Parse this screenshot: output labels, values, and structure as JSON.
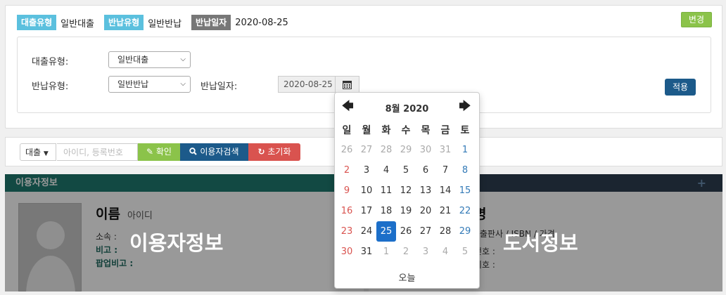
{
  "summary": {
    "loan_type_tag": "대출유형",
    "loan_type_value": "일반대출",
    "return_type_tag": "반납유형",
    "return_type_value": "일반반납",
    "return_date_tag": "반납일자",
    "return_date_value": "2020-08-25",
    "change_button": "변경"
  },
  "form": {
    "loan_type_label": "대출유형:",
    "loan_type_selected": "일반대출",
    "return_type_label": "반납유형:",
    "return_type_selected": "일반반납",
    "return_date_label": "반납일자:",
    "return_date_value": "2020-08-25",
    "apply_button": "적용"
  },
  "search": {
    "type_label": "대출",
    "placeholder": "아이디, 등록번호",
    "confirm_button": "확인",
    "user_search_button": "이용자검색",
    "reset_button": "초기화"
  },
  "user_panel": {
    "header": "이용자정보",
    "name_label": "이름",
    "id_label": "아이디",
    "affiliation_label": "소속 :",
    "note_label": "비고 :",
    "popup_note_label": "팝업비고 :",
    "overlay_text": "이용자정보"
  },
  "book_panel": {
    "title_partial": "명",
    "publisher_line": "/ 출판사 / ISBN / 가격",
    "number_partial": "번호 :",
    "symbol_partial": "기호 :",
    "overlay_text": "도서정보"
  },
  "datepicker": {
    "title": "8월 2020",
    "weekdays": [
      "일",
      "월",
      "화",
      "수",
      "목",
      "금",
      "토"
    ],
    "weeks": [
      [
        "26",
        "27",
        "28",
        "29",
        "30",
        "31",
        "1"
      ],
      [
        "2",
        "3",
        "4",
        "5",
        "6",
        "7",
        "8"
      ],
      [
        "9",
        "10",
        "11",
        "12",
        "13",
        "14",
        "15"
      ],
      [
        "16",
        "17",
        "18",
        "19",
        "20",
        "21",
        "22"
      ],
      [
        "23",
        "24",
        "25",
        "26",
        "27",
        "28",
        "29"
      ],
      [
        "30",
        "31",
        "1",
        "2",
        "3",
        "4",
        "5"
      ]
    ],
    "selected": "25",
    "today_button": "오늘"
  },
  "colors": {
    "info_blue": "#5bc0de",
    "success": "#8bc34a",
    "primary": "#1c5a8a",
    "danger": "#d9534f",
    "teal_header": "#1f7a70"
  }
}
